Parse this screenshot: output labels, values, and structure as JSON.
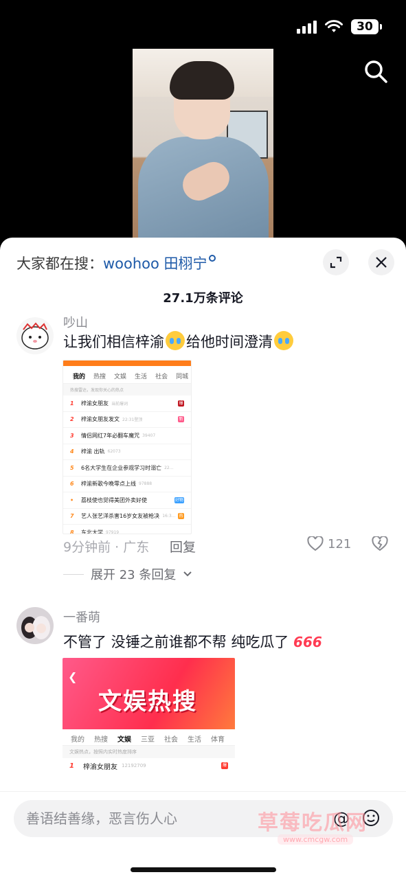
{
  "status_bar": {
    "battery": "30"
  },
  "sheet": {
    "search_prefix": "大家都在搜：",
    "search_keyword": "woohoo 田栩宁",
    "comment_count": "27.1万条评论"
  },
  "comments": [
    {
      "user": "吵山",
      "text_a": "让我们相信梓渝",
      "text_b": "给他时间澄清",
      "time_loc": "9分钟前 · 广东",
      "reply_label": "回复",
      "likes": "121",
      "expand_label": "展开 23 条回复",
      "screenshot": {
        "tabs": [
          "我的",
          "热搜",
          "文娱",
          "生活",
          "社会",
          "同城"
        ],
        "hint": "热搜雷达，发现你关心的热点",
        "rows": [
          {
            "rank": "1",
            "title": "梓渝女朋友",
            "num": "当前爆词",
            "tag": "爆"
          },
          {
            "rank": "2",
            "title": "梓渝女朋友发文",
            "num": "22:31登顶",
            "tag": "新"
          },
          {
            "rank": "3",
            "title": "情侣网红7年必翻车魔咒",
            "num": "39407",
            "tag": ""
          },
          {
            "rank": "4",
            "title": "梓渝 出轨",
            "num": "62073",
            "tag": ""
          },
          {
            "rank": "5",
            "title": "6名大学生在企业参观学习时溺亡",
            "num": "22...",
            "tag": ""
          },
          {
            "rank": "6",
            "title": "梓渝新歌今晚零点上线",
            "num": "97888",
            "tag": ""
          },
          {
            "rank": "•",
            "title": "荔枝使也觉得美团外卖好使",
            "num": "",
            "tag": "好物"
          },
          {
            "rank": "7",
            "title": "艺人张艺洋杀害16岁女友被枪决",
            "num": "16:3...",
            "tag": "热"
          },
          {
            "rank": "8",
            "title": "东北大学",
            "num": "97919",
            "tag": ""
          }
        ]
      }
    },
    {
      "user": "一番萌",
      "text_a": "不管了 没锤之前谁都不帮 纯吃瓜了",
      "badge": "666",
      "screenshot": {
        "banner_title": "文娱热搜",
        "tabs": [
          "我的",
          "热搜",
          "文娱",
          "三亚",
          "社会",
          "生活",
          "体育"
        ],
        "hint": "文娱热点，按照内实时热度排序",
        "rows": [
          {
            "rank": "1",
            "title": "梓渝女朋友",
            "num": "12192709",
            "tag": "爆"
          }
        ]
      }
    }
  ],
  "input": {
    "placeholder": "善语结善缘，恶言伤人心"
  },
  "watermark": {
    "text": "草莓吃瓜网",
    "url": "www.cmcgw.com"
  },
  "colors": {
    "link": "#1e5aa8",
    "accent_red": "#ff3b30",
    "hot_orange": "#ff7d1a"
  }
}
